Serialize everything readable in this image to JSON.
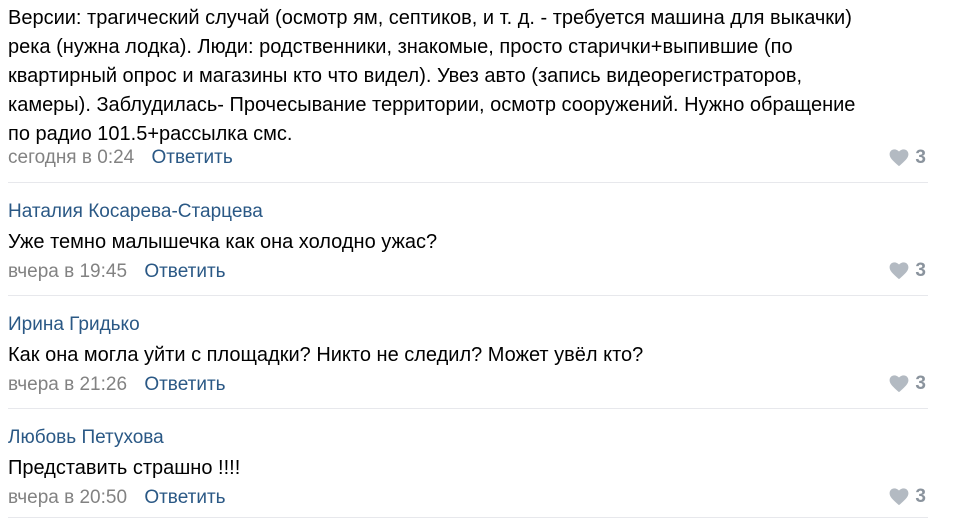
{
  "comments": [
    {
      "author": "",
      "lines": [
        "Версии: трагический случай (осмотр ям, септиков, и т. д. - требуется машина для выкачки)",
        "река (нужна лодка). Люди: родственники, знакомые, просто старички+выпившие (по",
        "квартирный опрос и магазины кто что видел). Увез авто (запись видеорегистраторов,",
        "камеры). Заблудилась- Прочесывание территории, осмотр сооружений. Нужно обращение",
        "по радио 101.5+рассылка смс."
      ],
      "time": "сегодня в 0:24",
      "reply_label": "Ответить",
      "likes": "3"
    },
    {
      "author": "Наталия Косарева-Старцева",
      "lines": [
        "Уже темно малышечка как она холодно ужас?"
      ],
      "time": "вчера в 19:45",
      "reply_label": "Ответить",
      "likes": "3"
    },
    {
      "author": "Ирина Гридько",
      "lines": [
        "Как она могла уйти с площадки? Никто не следил? Может увёл кто?"
      ],
      "time": "вчера в 21:26",
      "reply_label": "Ответить",
      "likes": "3"
    },
    {
      "author": "Любовь Петухова",
      "lines": [
        "Представить страшно !!!!"
      ],
      "time": "вчера в 20:50",
      "reply_label": "Ответить",
      "likes": "3"
    }
  ],
  "colors": {
    "link": "#2a5885",
    "muted": "#828282",
    "heart": "#b3bac2",
    "divider": "#e7e8ec"
  },
  "icons": {
    "like": "heart-icon"
  }
}
